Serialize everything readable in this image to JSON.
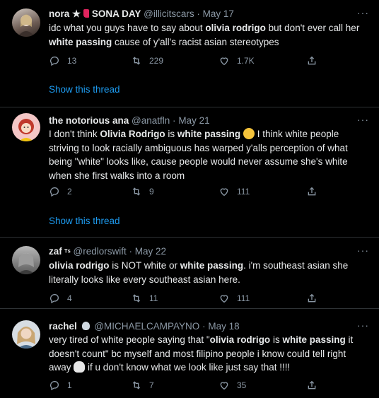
{
  "tweets": [
    {
      "name": "nora",
      "name_suffix": " ★ ",
      "name_tail": "SONA DAY",
      "handle": "@illicitscars",
      "sep": "·",
      "date": "May 17",
      "body": [
        {
          "t": "idc what you guys have to say about "
        },
        {
          "t": "olivia rodrigo",
          "b": true
        },
        {
          "t": " but don't ever call her "
        },
        {
          "t": "white passing",
          "b": true
        },
        {
          "t": " cause of y'all's racist asian stereotypes"
        }
      ],
      "replies": "13",
      "retweets": "229",
      "likes": "1.7K",
      "show_thread": "Show this thread"
    },
    {
      "name": "the notorious ana",
      "handle": "@anatfln",
      "sep": "·",
      "date": "May 21",
      "body": [
        {
          "t": "I don't think "
        },
        {
          "t": "Olivia Rodrigo",
          "b": true
        },
        {
          "t": " is "
        },
        {
          "t": "white passing",
          "b": true
        },
        {
          "t": " "
        },
        {
          "emoji": "grin-sweat"
        },
        {
          "t": " I think white people striving to look racially ambiguous has warped y'alls perception of what being \"white\" looks like, cause people would never assume she's white when she first walks into a room"
        }
      ],
      "replies": "2",
      "retweets": "9",
      "likes": "111",
      "show_thread": "Show this thread"
    },
    {
      "name": "zaf",
      "name_suffix": " ᵀˢ",
      "handle": "@redlorswift",
      "sep": "·",
      "date": "May 22",
      "body": [
        {
          "t": "olivia rodrigo",
          "b": true
        },
        {
          "t": " is NOT white or "
        },
        {
          "t": "white passing",
          "b": true
        },
        {
          "t": ". i'm southeast asian she literally looks like every southeast asian here."
        }
      ],
      "replies": "4",
      "retweets": "11",
      "likes": "111"
    },
    {
      "name": "rachel",
      "handle": "@MICHAELCAMPAYNO",
      "sep": "·",
      "date": "May 18",
      "body": [
        {
          "t": "very tired of white people saying that \""
        },
        {
          "t": "olivia rodrigo",
          "b": true
        },
        {
          "t": " is "
        },
        {
          "t": "white passing",
          "b": true
        },
        {
          "t": " it doesn't count\" bc myself and most filipino people i know could tell right away "
        },
        {
          "emoji": "skull"
        },
        {
          "t": " if u don't know what we look like just say that !!!!"
        }
      ],
      "replies": "1",
      "retweets": "7",
      "likes": "35"
    }
  ],
  "more_label": "···",
  "colors": {
    "accent": "#1d9bf0",
    "muted": "#8b98a5",
    "text": "#e7e9ea",
    "divider": "#2f3336"
  }
}
